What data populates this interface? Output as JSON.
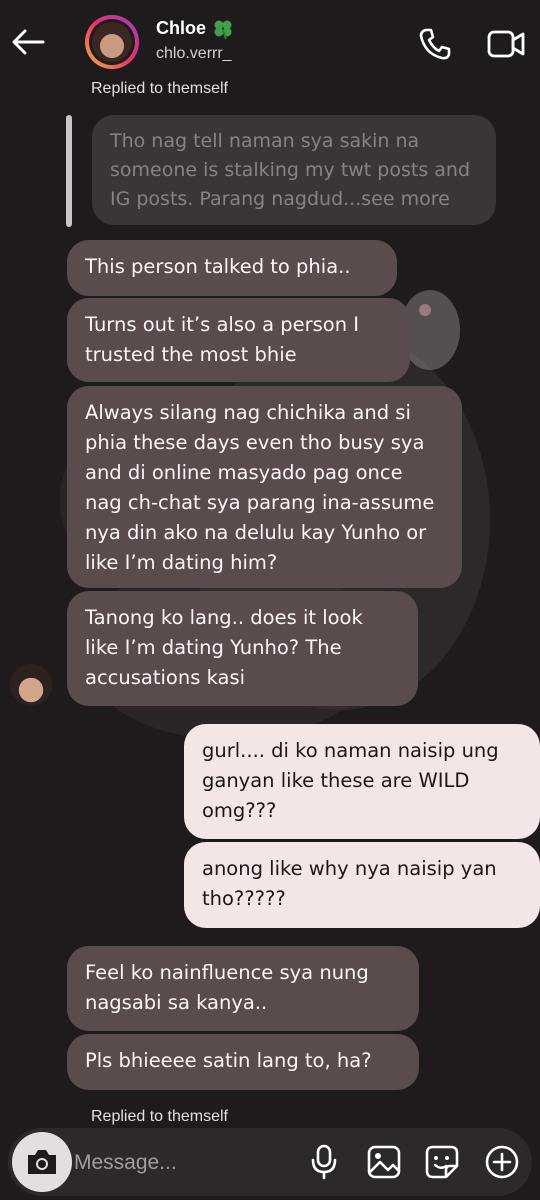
{
  "header": {
    "name": "Chloe",
    "handle": "chlo.verrr_",
    "icons": {
      "back": "back-arrow-icon",
      "call": "phone-icon",
      "video": "video-camera-icon",
      "badge": "four-leaf-clover-icon"
    }
  },
  "replied_label_top": "Replied to themself",
  "quoted_message": "Tho nag tell naman sya sakin na someone is stalking my twt posts and IG posts. Parang nagdud...see more",
  "messages": [
    {
      "from": "them",
      "text": "This person talked to phia.."
    },
    {
      "from": "them",
      "text": "Turns out it’s also a person I trusted the most bhie"
    },
    {
      "from": "them",
      "text": "Always silang nag chichika and si phia these days even tho busy sya and di online masyado pag once nag ch-chat sya parang ina-assume nya din ako na delulu kay Yunho or like I’m dating him?"
    },
    {
      "from": "them",
      "text": "Tanong ko lang.. does it look like I’m dating Yunho? The accusations kasi"
    },
    {
      "from": "me",
      "text": "gurl.... di ko naman naisip ung ganyan like these are WILD omg???"
    },
    {
      "from": "me",
      "text": "anong like why nya naisip yan tho?????"
    },
    {
      "from": "them",
      "text": "Feel ko nainfluence sya nung nagsabi sa kanya.."
    },
    {
      "from": "them",
      "text": "Pls bhieeee satin lang to, ha?"
    }
  ],
  "replied_label_bottom": "Replied to themself",
  "composer": {
    "placeholder": "Message...",
    "icons": [
      "camera-icon",
      "microphone-icon",
      "image-icon",
      "sticker-icon",
      "add-icon"
    ]
  },
  "colors": {
    "background": "#1f1b1c",
    "received_bubble": "#5a4c4d",
    "sent_bubble": "#f4e6e6",
    "quoted_bubble": "#3b3536"
  }
}
